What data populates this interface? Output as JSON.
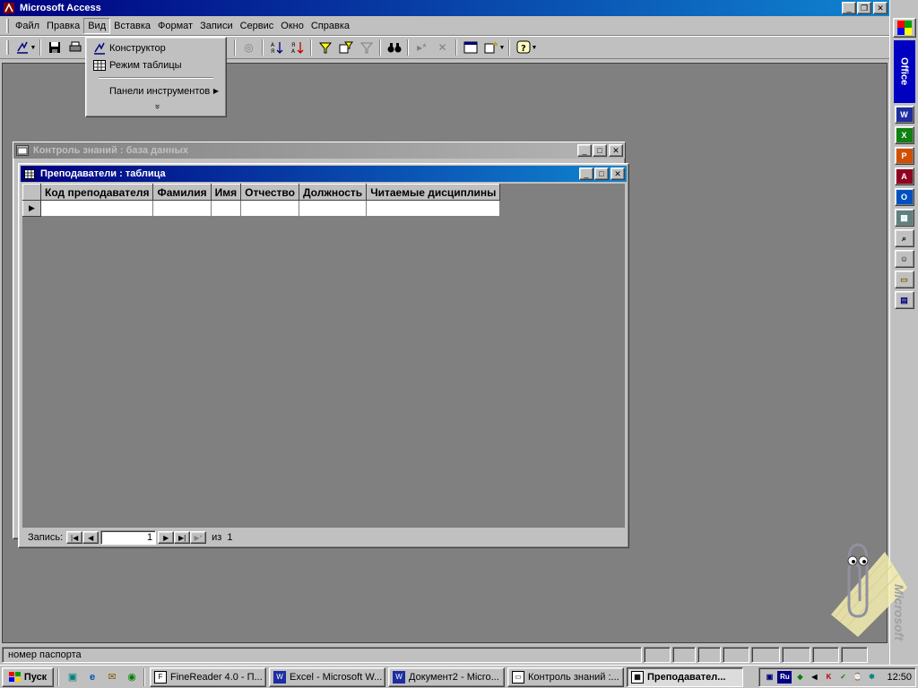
{
  "app": {
    "title": "Microsoft Access",
    "window_buttons": {
      "minimize": "_",
      "restore": "❐",
      "close": "✕"
    }
  },
  "menubar": {
    "items": [
      "Файл",
      "Правка",
      "Вид",
      "Вставка",
      "Формат",
      "Записи",
      "Сервис",
      "Окно",
      "Справка"
    ]
  },
  "view_menu": {
    "items": [
      {
        "label": "Конструктор",
        "icon": "design-view-icon"
      },
      {
        "label": "Режим таблицы",
        "icon": "datasheet-icon"
      },
      {
        "label": "Панели инструментов",
        "icon": ""
      }
    ],
    "more": "»"
  },
  "db_window": {
    "title": "Контроль знаний : база данных"
  },
  "table_window": {
    "title": "Преподаватели : таблица",
    "columns": [
      "Код преподавателя",
      "Фамилия",
      "Имя",
      "Отчество",
      "Должность",
      "Читаемые дисциплины"
    ],
    "nav": {
      "label": "Запись:",
      "current": "1",
      "of_label": "из",
      "total": "1"
    }
  },
  "statusbar": {
    "text": "номер паспорта"
  },
  "office_bar": {
    "label": "Office",
    "buttons": [
      "word-icon",
      "excel-icon",
      "powerpoint-icon",
      "access-icon",
      "outlook-icon",
      "calculator-icon",
      "find-icon",
      "contacts-icon",
      "folder-icon",
      "document-icon"
    ]
  },
  "clippy": {
    "brand": "Microsoft"
  },
  "taskbar": {
    "start_label": "Пуск",
    "tasks": [
      {
        "label": "FineReader 4.0 - П...",
        "icon": "finereader-icon",
        "active": false
      },
      {
        "label": "Excel - Microsoft W...",
        "icon": "word-icon",
        "active": false
      },
      {
        "label": "Документ2 - Micro...",
        "icon": "word-icon",
        "active": false
      },
      {
        "label": "Контроль знаний :...",
        "icon": "database-icon",
        "active": false
      },
      {
        "label": "Преподавател...",
        "icon": "table-icon",
        "active": true
      }
    ],
    "tray_lang": "Ru",
    "clock": "12:50"
  },
  "colors": {
    "title_active": "#000080",
    "desktop": "#808080",
    "face": "#c0c0c0"
  }
}
